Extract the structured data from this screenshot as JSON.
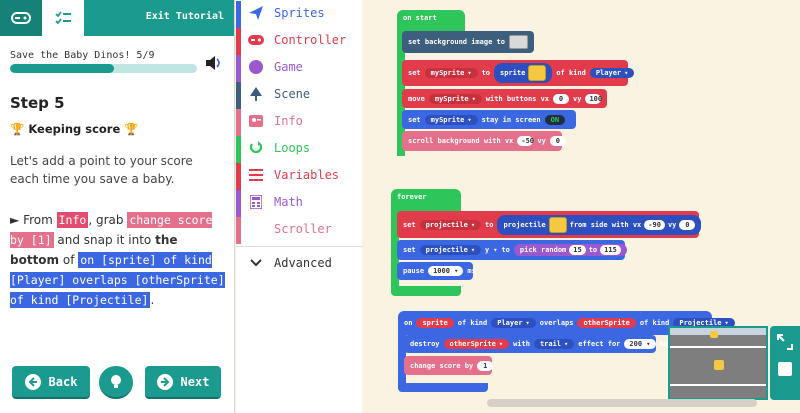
{
  "tutorial": {
    "exit_label": "Exit Tutorial",
    "progress_label": "Save the Baby Dinos! 5/9",
    "progress_fraction": 0.5556,
    "step_title": "Step 5",
    "step_subtitle": "Keeping score",
    "subtitle_icon": "trophy-icon",
    "intro": "Let's add a point to your score each time you save a baby.",
    "instruction": {
      "arrow": "►",
      "from": "From",
      "category": "Info",
      "grab": ", grab",
      "block": "change score by [1]",
      "snap": "and snap it into",
      "bold": "the bottom",
      "of": "of",
      "event_block": "on [sprite] of kind [Player] overlaps [otherSprite] of kind [Projectile]",
      "period": "."
    },
    "back_label": "Back",
    "next_label": "Next"
  },
  "toolbox": {
    "categories": [
      {
        "label": "Sprites",
        "color": "#3c67e3",
        "icon": "paper-plane-icon"
      },
      {
        "label": "Controller",
        "color": "#e23c4c",
        "icon": "gamepad-icon"
      },
      {
        "label": "Game",
        "color": "#9b59d0",
        "icon": "circle-icon"
      },
      {
        "label": "Scene",
        "color": "#3e5e7d",
        "icon": "tree-icon"
      },
      {
        "label": "Info",
        "color": "#e4708c",
        "icon": "id-card-icon"
      },
      {
        "label": "Loops",
        "color": "#2ec55a",
        "icon": "loop-icon"
      },
      {
        "label": "Variables",
        "color": "#e23c4c",
        "icon": "list-icon"
      },
      {
        "label": "Math",
        "color": "#9b59d0",
        "icon": "calculator-icon"
      },
      {
        "label": "Scroller",
        "color": "#e4708c",
        "icon": ""
      },
      {
        "label": "Advanced",
        "color": "#333333",
        "icon": "chevron-down-icon"
      }
    ]
  },
  "workspace": {
    "on_start": {
      "hat": "on start",
      "set_bg": "set background image to",
      "set": "set",
      "mySprite": "mySprite",
      "to": "to",
      "sprite": "sprite",
      "of_kind": "of kind",
      "Player": "Player",
      "move": "move",
      "with_buttons": "with buttons vx",
      "vx": "0",
      "vy_label": "vy",
      "vy": "100",
      "stay": "stay in screen",
      "on": "ON",
      "scroll": "scroll background with vx",
      "scroll_vx": "-50",
      "scroll_vy": "0"
    },
    "forever": {
      "hat": "forever",
      "set": "set",
      "projectile": "projectile",
      "to": "to",
      "from_side": "from side with vx",
      "vx": "-90",
      "vy_label": "vy",
      "vy": "0",
      "y": "y",
      "pick_random": "pick random",
      "rand_from": "15",
      "rand_to_label": "to",
      "rand_to": "115",
      "pause": "pause",
      "ms": "1000",
      "ms_label": "ms"
    },
    "overlap": {
      "on": "on",
      "sprite": "sprite",
      "of_kind": "of kind",
      "Player": "Player",
      "overlaps": "overlaps",
      "otherSprite": "otherSprite",
      "Projectile": "Projectile",
      "destroy": "destroy",
      "with": "with",
      "trail": "trail",
      "effect_for": "effect for",
      "ms": "200",
      "ms_label": "ms",
      "change_score": "change score by",
      "score_by": "1"
    }
  }
}
